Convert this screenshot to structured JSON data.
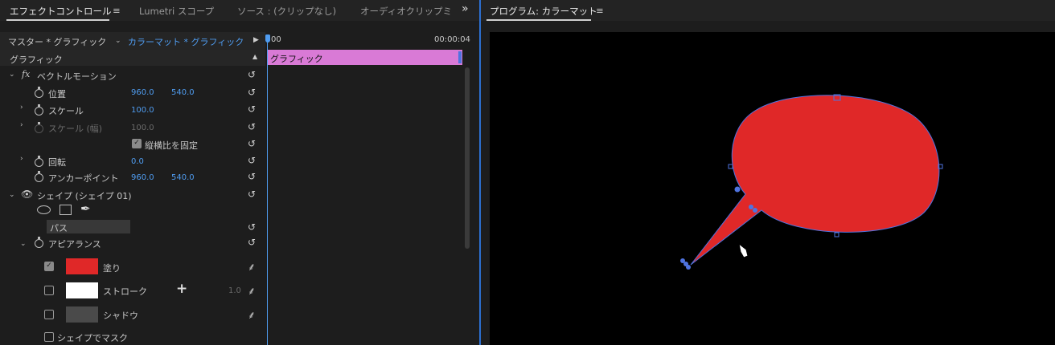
{
  "tabs": {
    "effect_controls": "エフェクトコントロール",
    "lumetri": "Lumetri スコープ",
    "source": "ソース : (クリップなし)",
    "audio": "オーディオクリップミ",
    "overflow": "»",
    "menu": "≡"
  },
  "program": {
    "title": "プログラム: カラーマット",
    "menu": "≡"
  },
  "clip_header": {
    "master": "マスター * グラフィック",
    "clip": "カラーマット * グラフィック",
    "time_start": "00",
    "time_end": "00:00:04"
  },
  "timeline_bar": {
    "label": "グラフィック",
    "color": "#d97ad6"
  },
  "section": "グラフィック",
  "vector_motion": {
    "fx": "fx",
    "label": "ベクトルモーション",
    "position_label": "位置",
    "position_x": "960.0",
    "position_y": "540.0",
    "scale_label": "スケール",
    "scale_value": "100.0",
    "scale_width_label": "スケール (幅)",
    "scale_width_value": "100.0",
    "uniform_label": "縦横比を固定",
    "rotation_label": "回転",
    "rotation_value": "0.0",
    "anchor_label": "アンカーポイント",
    "anchor_x": "960.0",
    "anchor_y": "540.0"
  },
  "shape": {
    "label": "シェイプ (シェイプ 01)",
    "path_label": "パス",
    "appearance_label": "アピアランス",
    "fill_label": "塗り",
    "fill_color": "#e02828",
    "stroke_label": "ストローク",
    "stroke_color": "#ffffff",
    "stroke_width": "1.0",
    "shadow_label": "シャドウ",
    "shadow_color": "#4a4a4a",
    "mask_label": "シェイプでマスク"
  },
  "colors": {
    "accent_blue": "#4f9cf0",
    "shape_red": "#e02828"
  }
}
